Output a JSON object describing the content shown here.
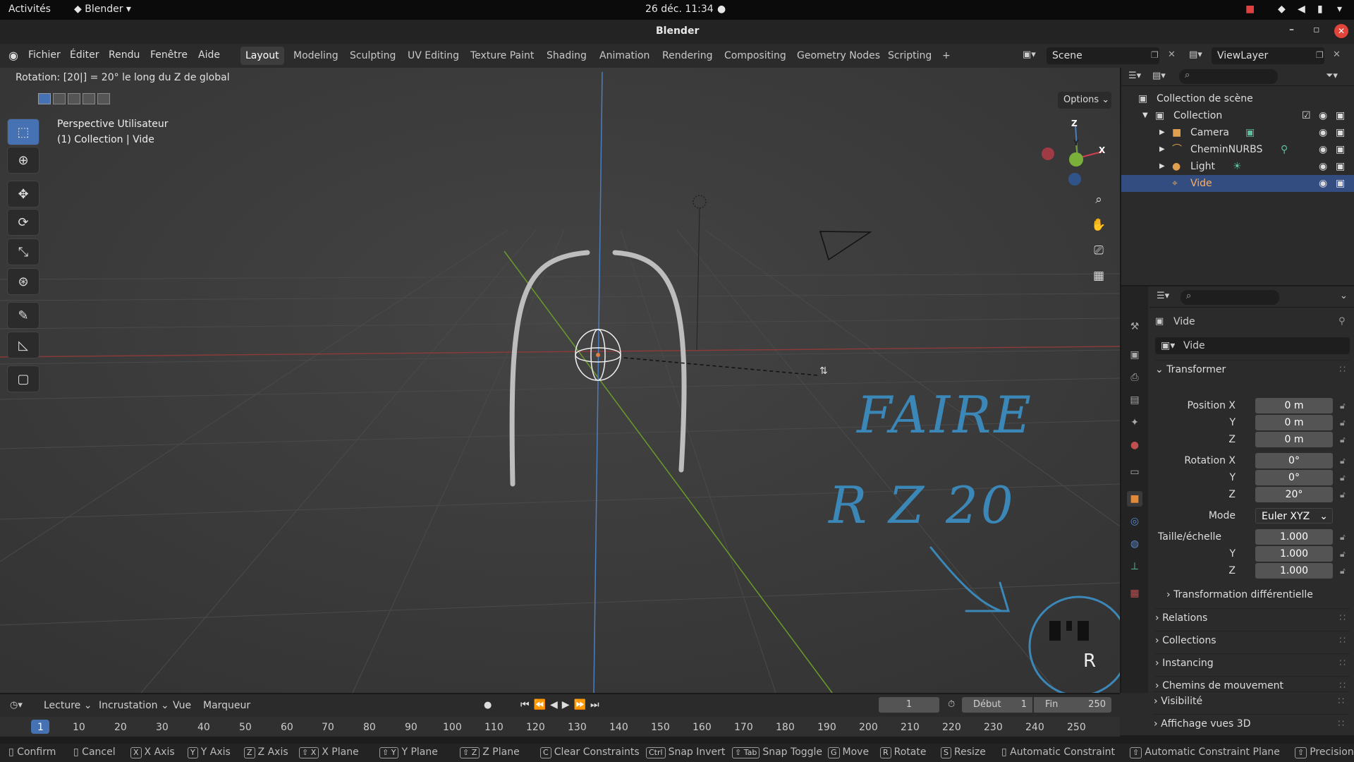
{
  "gnome": {
    "activities": "Activités",
    "app": "Blender",
    "clock": "26 déc.  11:34"
  },
  "window": {
    "title": "Blender"
  },
  "menus": [
    "Fichier",
    "Éditer",
    "Rendu",
    "Fenêtre",
    "Aide"
  ],
  "workspaces": [
    "Layout",
    "Modeling",
    "Sculpting",
    "UV Editing",
    "Texture Paint",
    "Shading",
    "Animation",
    "Rendering",
    "Compositing",
    "Geometry Nodes",
    "Scripting",
    "+"
  ],
  "scene": {
    "name": "Scene",
    "viewlayer": "ViewLayer"
  },
  "viewport": {
    "status": "Rotation: [20|] = 20°  le long du Z de global",
    "view_name": "Perspective Utilisateur",
    "view_sub": "(1) Collection | Vide",
    "options": "Options",
    "gizmo": {
      "z": "Z",
      "y": "Y",
      "x": "X"
    },
    "annotation": {
      "line1": "FAIRE",
      "line2": "R Z 20",
      "key": "R"
    }
  },
  "outliner": {
    "root": "Collection de scène",
    "collection": "Collection",
    "items": [
      {
        "label": "Camera"
      },
      {
        "label": "CheminNURBS"
      },
      {
        "label": "Light"
      },
      {
        "label": "Vide"
      }
    ]
  },
  "properties": {
    "object_name": "Vide",
    "datablock": "Vide",
    "transform_title": "Transformer",
    "location": {
      "label": "Position X",
      "x": "0 m",
      "y": "0 m",
      "z": "0 m"
    },
    "rotation": {
      "label": "Rotation X",
      "x": "0°",
      "y": "0°",
      "z": "20°"
    },
    "mode": {
      "label": "Mode",
      "value": "Euler XYZ"
    },
    "scale": {
      "label": "Taille/échelle",
      "x": "1.000",
      "y": "1.000",
      "z": "1.000"
    },
    "axis": {
      "y": "Y",
      "z": "Z"
    },
    "delta": "Transformation différentielle",
    "panels": [
      "Relations",
      "Collections",
      "Instancing",
      "Chemins de mouvement",
      "Visibilité",
      "Affichage vues 3D"
    ]
  },
  "timeline": {
    "menus": [
      "Lecture",
      "Incrustation",
      "Vue",
      "Marqueur"
    ],
    "current": "1",
    "start_label": "Début",
    "start": "1",
    "end_label": "Fin",
    "end": "250",
    "ticks": [
      "1",
      "10",
      "20",
      "30",
      "40",
      "50",
      "60",
      "70",
      "80",
      "90",
      "100",
      "110",
      "120",
      "130",
      "140",
      "150",
      "160",
      "170",
      "180",
      "190",
      "200",
      "210",
      "220",
      "230",
      "240",
      "250"
    ]
  },
  "statusbar": [
    {
      "key": "",
      "label": "Confirm"
    },
    {
      "key": "",
      "label": "Cancel"
    },
    {
      "key": "X",
      "label": "X Axis"
    },
    {
      "key": "Y",
      "label": "Y Axis"
    },
    {
      "key": "Z",
      "label": "Z Axis"
    },
    {
      "key": "⇧ X",
      "label": "X Plane"
    },
    {
      "key": "⇧ Y",
      "label": "Y Plane"
    },
    {
      "key": "⇧ Z",
      "label": "Z Plane"
    },
    {
      "key": "C",
      "label": "Clear Constraints"
    },
    {
      "key": "Ctrl",
      "label": "Snap Invert"
    },
    {
      "key": "⇧ Tab",
      "label": "Snap Toggle"
    },
    {
      "key": "G",
      "label": "Move"
    },
    {
      "key": "R",
      "label": "Rotate"
    },
    {
      "key": "S",
      "label": "Resize"
    },
    {
      "key": "",
      "label": "Automatic Constraint"
    },
    {
      "key": "⇧",
      "label": "Automatic Constraint Plane"
    },
    {
      "key": "⇧",
      "label": "Precision"
    }
  ]
}
